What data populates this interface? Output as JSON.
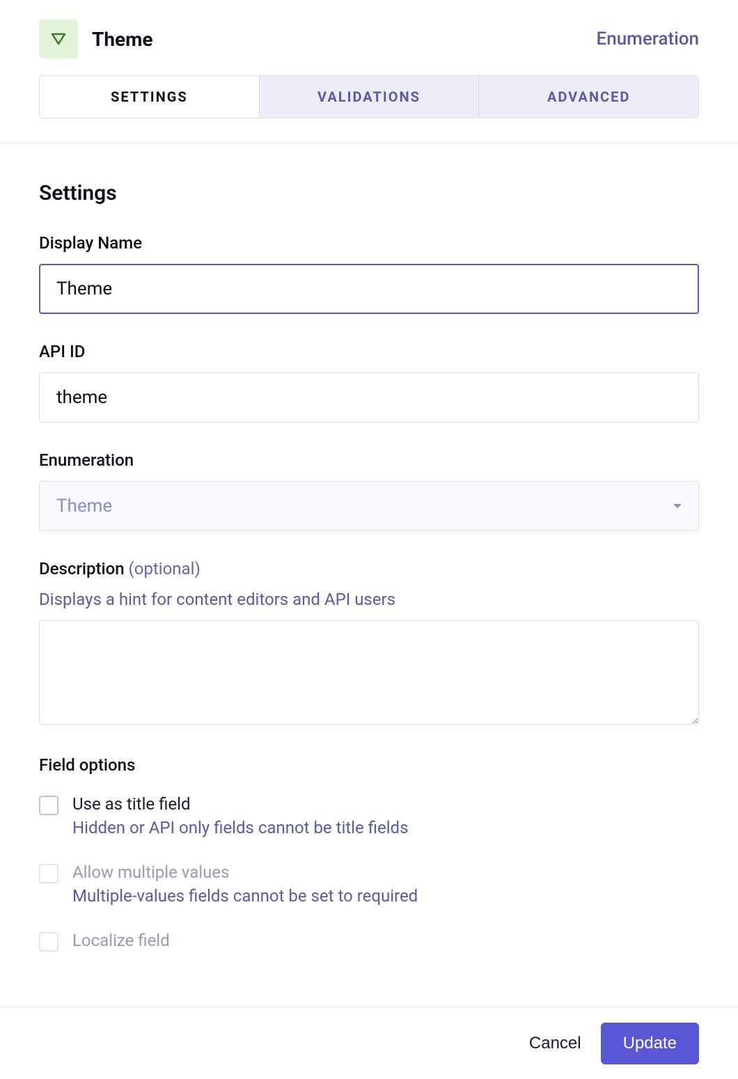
{
  "header": {
    "title": "Theme",
    "type_label": "Enumeration"
  },
  "tabs": {
    "settings": "SETTINGS",
    "validations": "VALIDATIONS",
    "advanced": "ADVANCED"
  },
  "section_title": "Settings",
  "fields": {
    "display_name": {
      "label": "Display Name",
      "value": "Theme"
    },
    "api_id": {
      "label": "API ID",
      "value": "theme"
    },
    "enumeration": {
      "label": "Enumeration",
      "selected": "Theme"
    },
    "description": {
      "label": "Description ",
      "optional": "(optional)",
      "hint": "Displays a hint for content editors and API users",
      "value": ""
    }
  },
  "options": {
    "title": "Field options",
    "use_as_title": {
      "label": "Use as title field",
      "hint": "Hidden or API only fields cannot be title fields"
    },
    "allow_multiple": {
      "label": "Allow multiple values",
      "hint": "Multiple-values fields cannot be set to required"
    },
    "localize": {
      "label": "Localize field"
    }
  },
  "footer": {
    "cancel": "Cancel",
    "update": "Update"
  }
}
